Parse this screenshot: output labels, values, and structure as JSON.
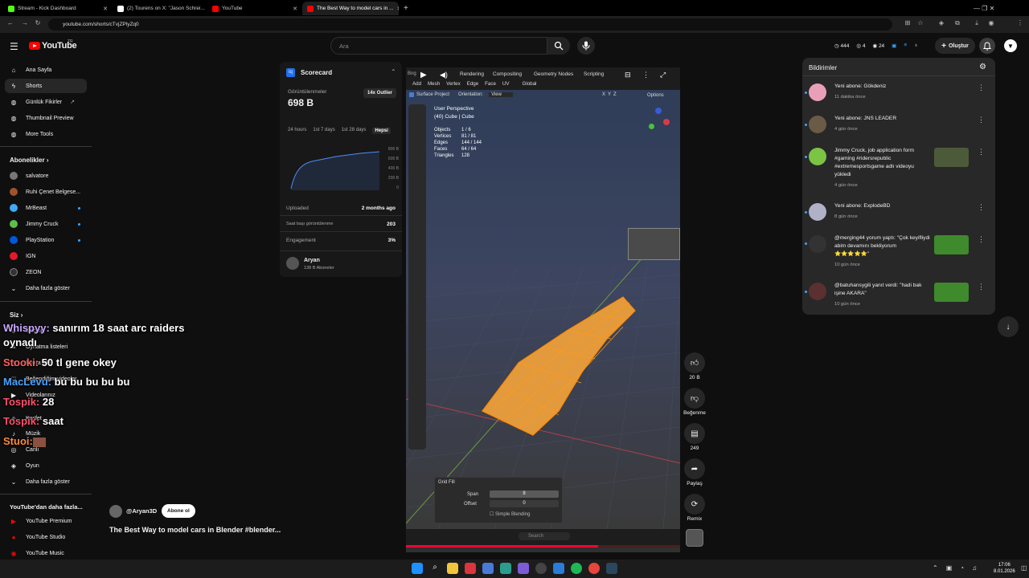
{
  "browser": {
    "tabs": [
      {
        "title": "Stream - Kick Dashboard",
        "color": "#53fc18"
      },
      {
        "title": "(2) Tourens on X: \"Jason Schrei...",
        "color": "#ffffff"
      },
      {
        "title": "YouTube",
        "color": "#ff0000"
      },
      {
        "title": "The Best Way to model cars in ...",
        "color": "#ff0000"
      }
    ],
    "new_tab": "+",
    "url": "youtube.com/shorts/cTvjZPlyZq0"
  },
  "header": {
    "logo_text": "YouTube",
    "logo_sup": "TR",
    "search_placeholder": "Ara",
    "stats": [
      "444",
      "4",
      "24"
    ],
    "create_label": "Oluştur"
  },
  "sidebar": {
    "main": [
      {
        "label": "Ana Sayfa",
        "icon": "home-icon"
      },
      {
        "label": "Shorts",
        "icon": "shorts-icon"
      },
      {
        "label": "Günlük Fikirler",
        "icon": "bulb-icon"
      },
      {
        "label": "Thumbnail Preview",
        "icon": "preview-icon"
      },
      {
        "label": "More Tools",
        "icon": "tools-icon"
      }
    ],
    "subs_title": "Abonelikler",
    "subs": [
      {
        "label": "salvatore",
        "color": "#777"
      },
      {
        "label": "Ruhi Çenet Belgese...",
        "color": "#a0522d"
      },
      {
        "label": "MrBeast",
        "color": "#3fa9f5"
      },
      {
        "label": "Jimmy Cruck",
        "color": "#5cbf4a"
      },
      {
        "label": "PlayStation",
        "color": "#0057d9"
      },
      {
        "label": "IGN",
        "color": "#e3192b"
      },
      {
        "label": "ZEON",
        "color": "#333"
      },
      {
        "label": "Daha fazla göster",
        "color": ""
      }
    ],
    "you_title": "Siz",
    "you": [
      "Geçmiş",
      "Oynatma listeleri",
      "Sonra izle",
      "Beğendiğim videolar",
      "Videolarınız",
      "Keşfet",
      "Müzik",
      "Canlı",
      "Oyun",
      "Daha fazla göster"
    ],
    "more_title": "YouTube'dan daha fazla...",
    "more": [
      "YouTube Premium",
      "YouTube Studio",
      "YouTube Music"
    ]
  },
  "scorecard": {
    "title": "Scorecard",
    "views_label": "Görüntülenmeler",
    "views": "698 B",
    "badge": "14x Outlier",
    "ranges": [
      "24 hours",
      "1st 7 days",
      "1st 28 days",
      "Hepsi"
    ],
    "y_ticks": [
      "800 B",
      "600 B",
      "400 B",
      "200 B",
      "0"
    ],
    "rows": [
      {
        "label": "Uploaded",
        "value": "2 months ago"
      },
      {
        "label": "Saat başı görüntülenme",
        "value": "203"
      },
      {
        "label": "Engagement",
        "value": "3%"
      }
    ],
    "channel": "Aryan",
    "channel_subs": "138 B Aboneler"
  },
  "blender": {
    "tabs": [
      "Rendering",
      "Compositing",
      "Geometry Nodes",
      "Scripting"
    ],
    "menu": [
      "Add",
      "Mesh",
      "Vertex",
      "Edge",
      "Face",
      "UV"
    ],
    "transform": "Global",
    "surface_project": "Surface Project",
    "orientation_label": "Orientation:",
    "orientation": "View",
    "options": "Options",
    "axes": [
      "X",
      "Y",
      "Z"
    ],
    "perspective": "User Perspective",
    "object": "(40) Cube | Cube",
    "stats": [
      {
        "k": "Objects",
        "v": "1 / 6"
      },
      {
        "k": "Vertices",
        "v": "81 / 81"
      },
      {
        "k": "Edges",
        "v": "144 / 144"
      },
      {
        "k": "Faces",
        "v": "64 / 64"
      },
      {
        "k": "Triangles",
        "v": "128"
      }
    ],
    "panel_title": "Grid Fill",
    "span_label": "Span",
    "span_value": "8",
    "offset_label": "Offset",
    "offset_value": "0",
    "simple_blending": "Simple Blending",
    "search": "Search"
  },
  "channel": {
    "handle": "@Aryan3D",
    "subscribe": "Abone ol",
    "video_title": "The Best Way to model cars in Blender #blender..."
  },
  "actions": [
    {
      "label": "20 B",
      "icon": "like-icon"
    },
    {
      "label": "Beğenme",
      "icon": "dislike-icon"
    },
    {
      "label": "249",
      "icon": "comment-icon"
    },
    {
      "label": "Paylaş",
      "icon": "share-icon"
    },
    {
      "label": "Remix",
      "icon": "remix-icon"
    }
  ],
  "notifications": {
    "title": "Bildirimler",
    "items": [
      {
        "text": "Yeni abone: Gökdeniz",
        "time": "11 dakika önce",
        "avatar": "#e8a0b8",
        "thumb": false
      },
      {
        "text": "Yeni abone: JNS LEADER",
        "time": "4 gün önce",
        "avatar": "#6b5a46",
        "thumb": false
      },
      {
        "text": "Jimmy Cruck, job application form #gaming #ridersrepublic #extremesportsgame adlı videoyu yükledi",
        "time": "4 gün önce",
        "avatar": "#7cc444",
        "thumb": true,
        "thumb_color": "#4d5a3a"
      },
      {
        "text": "Yeni abone: ExplodeBD",
        "time": "8 gün önce",
        "avatar": "#b0b0c8",
        "thumb": false
      },
      {
        "text": "@merging44 yorum yaptı: \"Çok keyifliydi abim devamını bekliyorum ⭐⭐⭐⭐⭐\"",
        "time": "10 gün önce",
        "avatar": "#333",
        "thumb": true,
        "thumb_color": "#3e8a2c"
      },
      {
        "text": "@batuhansygili yanıt verdi: \"hadi bak işine AKARA\"",
        "time": "10 gün önce",
        "avatar": "#5a3030",
        "thumb": true,
        "thumb_color": "#3e8a2c"
      }
    ]
  },
  "chat": [
    {
      "name": "Whispyy:",
      "msg": " sanırım 18 saat arc raiders"
    },
    {
      "name": "",
      "msg": "oynadı"
    },
    {
      "name": "Stooki:",
      "msg": " 50 tl gene okey"
    },
    {
      "name": "MacLevu:",
      "msg": " bu bu bu bu bu"
    },
    {
      "name": "Tospik:",
      "msg": " 28"
    },
    {
      "name": "Tospik:",
      "msg": " saat"
    },
    {
      "name": "Stuoi:",
      "msg": ""
    }
  ],
  "taskbar": {
    "time": "17:06",
    "date": "8.01.2026"
  }
}
